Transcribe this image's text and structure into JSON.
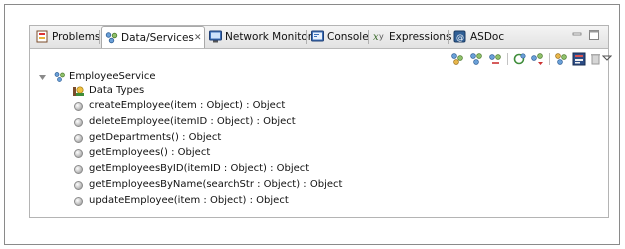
{
  "tabs": [
    {
      "label": "Problems",
      "icon": "problems-icon",
      "active": false
    },
    {
      "label": "Data/Services",
      "icon": "data-services-icon",
      "active": true,
      "close": "✕"
    },
    {
      "label": "Network Monitor",
      "icon": "network-monitor-icon",
      "active": false
    },
    {
      "label": "Console",
      "icon": "console-icon",
      "active": false
    },
    {
      "label": "Expressions",
      "icon": "expressions-icon",
      "active": false
    },
    {
      "label": "ASDoc",
      "icon": "asdoc-icon",
      "active": false
    }
  ],
  "tree": {
    "service": "EmployeeService",
    "data_types": "Data Types",
    "operations": [
      "createEmployee(item : Object) : Object",
      "deleteEmployee(itemID : Object) : Object",
      "getDepartments() : Object",
      "getEmployees() : Object",
      "getEmployeesByID(itemID : Object) : Object",
      "getEmployeesByName(searchStr : Object) : Object",
      "updateEmployee(item : Object) : Object"
    ]
  },
  "toolbar_icons": [
    "connect-to-data-icon",
    "configure-service-icon",
    "generate-service-call-icon",
    "refresh-icon",
    "configure-return-type-icon",
    "enable-data-management-icon",
    "generate-form-icon",
    "delete-icon",
    "view-menu-icon"
  ],
  "colors": {
    "accent_blue": "#2a5fb0",
    "panel_border": "#b4b4b4"
  }
}
